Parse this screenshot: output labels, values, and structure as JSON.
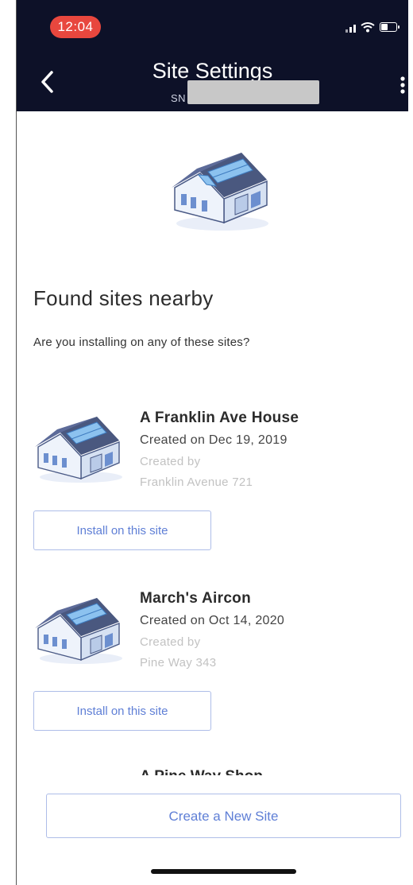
{
  "status_bar": {
    "time": "12:04"
  },
  "header": {
    "title": "Site Settings",
    "subtitle_prefix": "SN",
    "back_icon": "chevron-left-icon",
    "menu_icon": "more-vertical-icon"
  },
  "main": {
    "heading": "Found sites nearby",
    "subheading": "Are you installing on any of these sites?",
    "sites": [
      {
        "name": "A Franklin Ave House",
        "created": "Created on Dec 19, 2019",
        "created_by": "Created by",
        "address": "Franklin Avenue 721",
        "button": "Install on this site"
      },
      {
        "name": "March's Aircon",
        "created": "Created on Oct 14, 2020",
        "created_by": "Created by",
        "address": "Pine Way 343",
        "button": "Install on this site"
      }
    ],
    "partial_next_site": "A Pine Way Shop"
  },
  "footer": {
    "create_button": "Create a New Site"
  },
  "colors": {
    "header_bg": "#0d1128",
    "time_pill": "#e8473e",
    "accent": "#5f7fd6",
    "button_border": "#aebde8"
  }
}
